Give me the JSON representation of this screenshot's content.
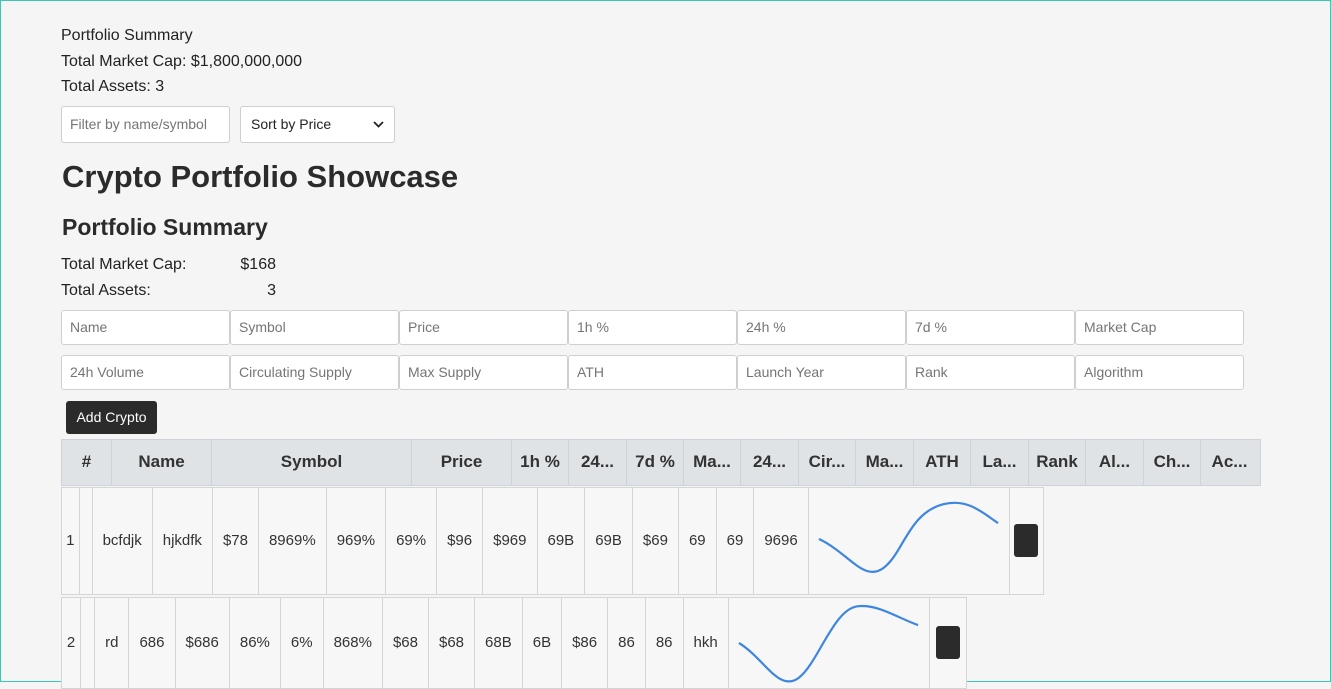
{
  "top_summary": {
    "heading": "Portfolio Summary",
    "market_cap": "Total Market Cap: $1,800,000,000",
    "assets": "Total Assets: 3"
  },
  "filters": {
    "filter_placeholder": "Filter by name/symbol",
    "sort_selected": "Sort by Price"
  },
  "title": "Crypto Portfolio Showcase",
  "summary": {
    "heading": "Portfolio Summary",
    "market_cap_label": "Total Market Cap:",
    "market_cap_value": "$168",
    "assets_label": "Total Assets:",
    "assets_value": "3"
  },
  "form": {
    "row1": [
      "Name",
      "Symbol",
      "Price",
      "1h %",
      "24h %",
      "7d %",
      "Market Cap"
    ],
    "row2": [
      "24h Volume",
      "Circulating Supply",
      "Max Supply",
      "ATH",
      "Launch Year",
      "Rank",
      "Algorithm"
    ],
    "add_label": "Add Crypto"
  },
  "table": {
    "headers": [
      "#",
      "Name",
      "Symbol",
      "Price",
      "1h %",
      "24...",
      "7d %",
      "Ma...",
      "24...",
      "Cir...",
      "Ma...",
      "ATH",
      "La...",
      "Rank",
      "Al...",
      "Ch...",
      "Ac..."
    ],
    "rows": [
      {
        "index": "1",
        "cells": [
          "bcfdjk",
          "hjkdfk",
          "$78",
          "8969%",
          "969%",
          "69%",
          "$96",
          "$969",
          "69B",
          "69B",
          "$69",
          "69",
          "69",
          "9696"
        ]
      },
      {
        "index": "2",
        "cells": [
          "rd",
          "686",
          "$686",
          "86%",
          "6%",
          "868%",
          "$68",
          "$68",
          "68B",
          "6B",
          "$86",
          "86",
          "86",
          "hkh"
        ]
      }
    ]
  },
  "colors": {
    "sparkline": "#3d86e0",
    "button": "#2b2b2b",
    "header_bg": "#dfe3e6"
  }
}
